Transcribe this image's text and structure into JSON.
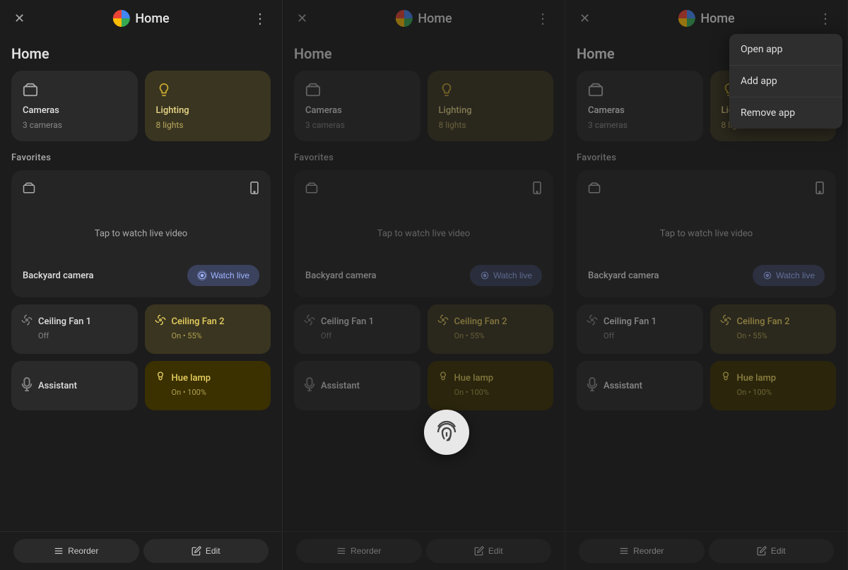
{
  "panels": [
    {
      "id": "panel1",
      "header": {
        "title": "Home",
        "close_label": "×",
        "dots_label": "⋮"
      },
      "section_title": "Home",
      "categories": [
        {
          "name": "Cameras",
          "sub": "3 cameras",
          "icon": "📷",
          "active": false
        },
        {
          "name": "Lighting",
          "sub": "8 lights",
          "icon": "💡",
          "active": true
        }
      ],
      "favorites_label": "Favorites",
      "camera": {
        "name": "Backyard camera",
        "tap_text": "Tap to watch live video",
        "watch_live": "Watch live"
      },
      "devices": [
        {
          "name": "Ceiling Fan 1",
          "status": "Off",
          "active": false,
          "icon": "💡"
        },
        {
          "name": "Ceiling Fan 2",
          "status": "On • 55%",
          "active": true,
          "icon": "💡"
        },
        {
          "name": "Assistant",
          "active": false,
          "icon": "🎤"
        },
        {
          "name": "Hue lamp",
          "status": "On • 100%",
          "active": true,
          "icon": "💡"
        }
      ],
      "footer": {
        "reorder": "Reorder",
        "edit": "Edit"
      }
    },
    {
      "id": "panel2",
      "header": {
        "title": "Home",
        "close_label": "×",
        "dots_label": "⋮"
      },
      "section_title": "Home",
      "categories": [
        {
          "name": "Cameras",
          "sub": "3 cameras",
          "icon": "📷",
          "active": false
        },
        {
          "name": "Lighting",
          "sub": "8 lights",
          "icon": "💡",
          "active": true
        }
      ],
      "favorites_label": "Favorites",
      "camera": {
        "name": "Backyard camera",
        "tap_text": "Tap to watch live video",
        "watch_live": "Watch live"
      },
      "devices": [
        {
          "name": "Ceiling Fan 1",
          "status": "Off",
          "active": false,
          "icon": "💡"
        },
        {
          "name": "Ceiling Fan 2",
          "status": "On • 55%",
          "active": true,
          "icon": "💡"
        },
        {
          "name": "Assistant",
          "active": false,
          "icon": "🎤"
        },
        {
          "name": "Hue lamp",
          "status": "On • 100%",
          "active": true,
          "icon": "💡"
        }
      ],
      "footer": {
        "reorder": "Reorder",
        "edit": "Edit"
      }
    },
    {
      "id": "panel3",
      "header": {
        "title": "Home",
        "close_label": "×",
        "dots_label": "⋮"
      },
      "section_title": "Home",
      "categories": [
        {
          "name": "Cameras",
          "sub": "3 cameras",
          "icon": "📷",
          "active": false
        },
        {
          "name": "Lighting",
          "sub": "8 lights",
          "icon": "💡",
          "active": true
        }
      ],
      "favorites_label": "Favorites",
      "camera": {
        "name": "Backyard camera",
        "tap_text": "Tap to watch live video",
        "watch_live": "Watch live"
      },
      "devices": [
        {
          "name": "Ceiling Fan 1",
          "status": "Off",
          "active": false,
          "icon": "💡"
        },
        {
          "name": "Ceiling Fan 2",
          "status": "On • 55%",
          "active": true,
          "icon": "💡"
        },
        {
          "name": "Assistant",
          "active": false,
          "icon": "🎤"
        },
        {
          "name": "Hue lamp",
          "status": "On • 100%",
          "active": true,
          "icon": "💡"
        }
      ],
      "footer": {
        "reorder": "Reorder",
        "edit": "Edit"
      }
    }
  ],
  "context_menu": {
    "items": [
      "Open app",
      "Add app",
      "Remove app"
    ]
  },
  "fab": {
    "icon": "fingerprint"
  },
  "colors": {
    "active_bg": "#3a3520",
    "active_text": "#e8d060",
    "panel_bg": "#1c1c1c",
    "card_bg": "#2a2a2a"
  }
}
